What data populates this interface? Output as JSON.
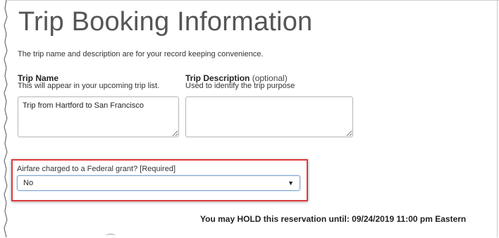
{
  "page": {
    "title": "Trip Booking Information",
    "subtitle": "The trip name and description are for your record keeping convenience."
  },
  "trip_name": {
    "label": "Trip Name",
    "hint": "This will appear in your upcoming trip list.",
    "value": "Trip from Hartford to San Francisco"
  },
  "trip_description": {
    "label": "Trip Description",
    "optional": " (optional)",
    "hint": "Used to identify the trip purpose",
    "value": ""
  },
  "grant": {
    "label": "Airfare charged to a Federal grant? [Required]",
    "selected": "No",
    "highlight_color": "#e0393c"
  },
  "hold_notice": "You may HOLD this reservation until: 09/24/2019 11:00 pm Eastern",
  "icons": {
    "dropdown": "dropdown-arrow-icon",
    "resize": "resize-grip-icon"
  }
}
